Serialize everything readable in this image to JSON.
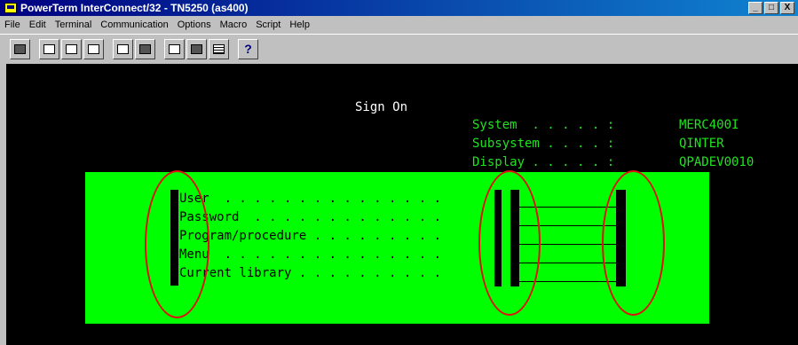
{
  "window": {
    "title": "PowerTerm InterConnect/32 - TN5250 (as400)",
    "minimize_label": "_",
    "restore_label": "□",
    "close_label": "X"
  },
  "menu": [
    "File",
    "Edit",
    "Terminal",
    "Communication",
    "Options",
    "Macro",
    "Script",
    "Help"
  ],
  "toolbar": {
    "icons": [
      "print-screen-icon",
      "connect-icon",
      "copy-icon",
      "paste-icon",
      "print-icon",
      "capture-icon",
      "session-icon",
      "keyboard-icon",
      "grid-icon",
      "help-icon"
    ],
    "help_glyph": "?"
  },
  "terminal": {
    "heading": "Sign On",
    "info": [
      {
        "label": "System  . . . . . :",
        "value": "MERC400I"
      },
      {
        "label": "Subsystem . . . . :",
        "value": "QINTER"
      },
      {
        "label": "Display . . . . . :",
        "value": "QPADEV0010"
      }
    ],
    "fields": [
      {
        "label": "User  . . . . . . . . . . . . . . ."
      },
      {
        "label": "Password  . . . . . . . . . . . . ."
      },
      {
        "label": "Program/procedure . . . . . . . . ."
      },
      {
        "label": "Menu  . . . . . . . . . . . . . . ."
      },
      {
        "label": "Current library . . . . . . . . . ."
      }
    ]
  },
  "colors": {
    "screen_bg": "#000000",
    "panel_bg": "#00ff00",
    "annotation": "#e01010",
    "title_bar": "#000080"
  }
}
